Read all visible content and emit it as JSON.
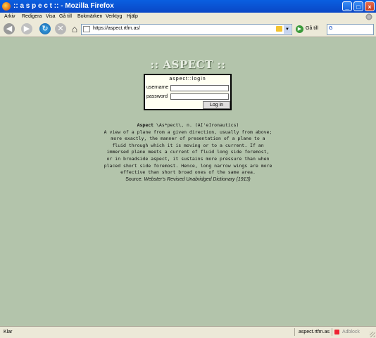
{
  "window": {
    "title": ":: a s p e c t :: - Mozilla Firefox",
    "buttons": {
      "minimize": "_",
      "maximize": "□",
      "close": "×"
    }
  },
  "menu": {
    "items": [
      "Arkiv",
      "Redigera",
      "Visa",
      "Gå till",
      "Bokmärken",
      "Verktyg",
      "Hjälp"
    ]
  },
  "toolbar": {
    "url": "https://aspect.rtfm.as/",
    "go_label": "Gå till",
    "search_engine": "G",
    "icons": [
      "back-icon",
      "forward-icon",
      "reload-icon",
      "stop-icon",
      "home-icon"
    ]
  },
  "page": {
    "logo": ":: ASPECT ::",
    "login": {
      "heading": "aspect::login",
      "username_label": "username",
      "password_label": "password",
      "username_value": "",
      "password_value": "",
      "button": "Log in"
    },
    "definition": {
      "headword": "Aspect",
      "header_rest": " \\As*pect\\, n. (A['e]ronautics)",
      "lines": [
        "A view of a plane from a given direction, usually from above;",
        "more exactly, the manner of presentation of a plane to a",
        "fluid through which it is moving or to a current. If an",
        "immersed plane meets a current of fluid long side foremost,",
        "or in broadside aspect, it sustains more pressure than when",
        "placed short side foremost. Hence, long narrow wings are more",
        "effective than short broad ones of the same area."
      ]
    },
    "source_prefix": "Source: ",
    "source_title": "Webster's Revised Unabridged Dictionary (1913)"
  },
  "status": {
    "text": "Klar",
    "host": "aspect.rtfm.as",
    "addon": "Adblock"
  },
  "colors": {
    "page_background": "#b3c4ab",
    "titlebar": "#0a5fe0",
    "chrome": "#ece9d8"
  }
}
